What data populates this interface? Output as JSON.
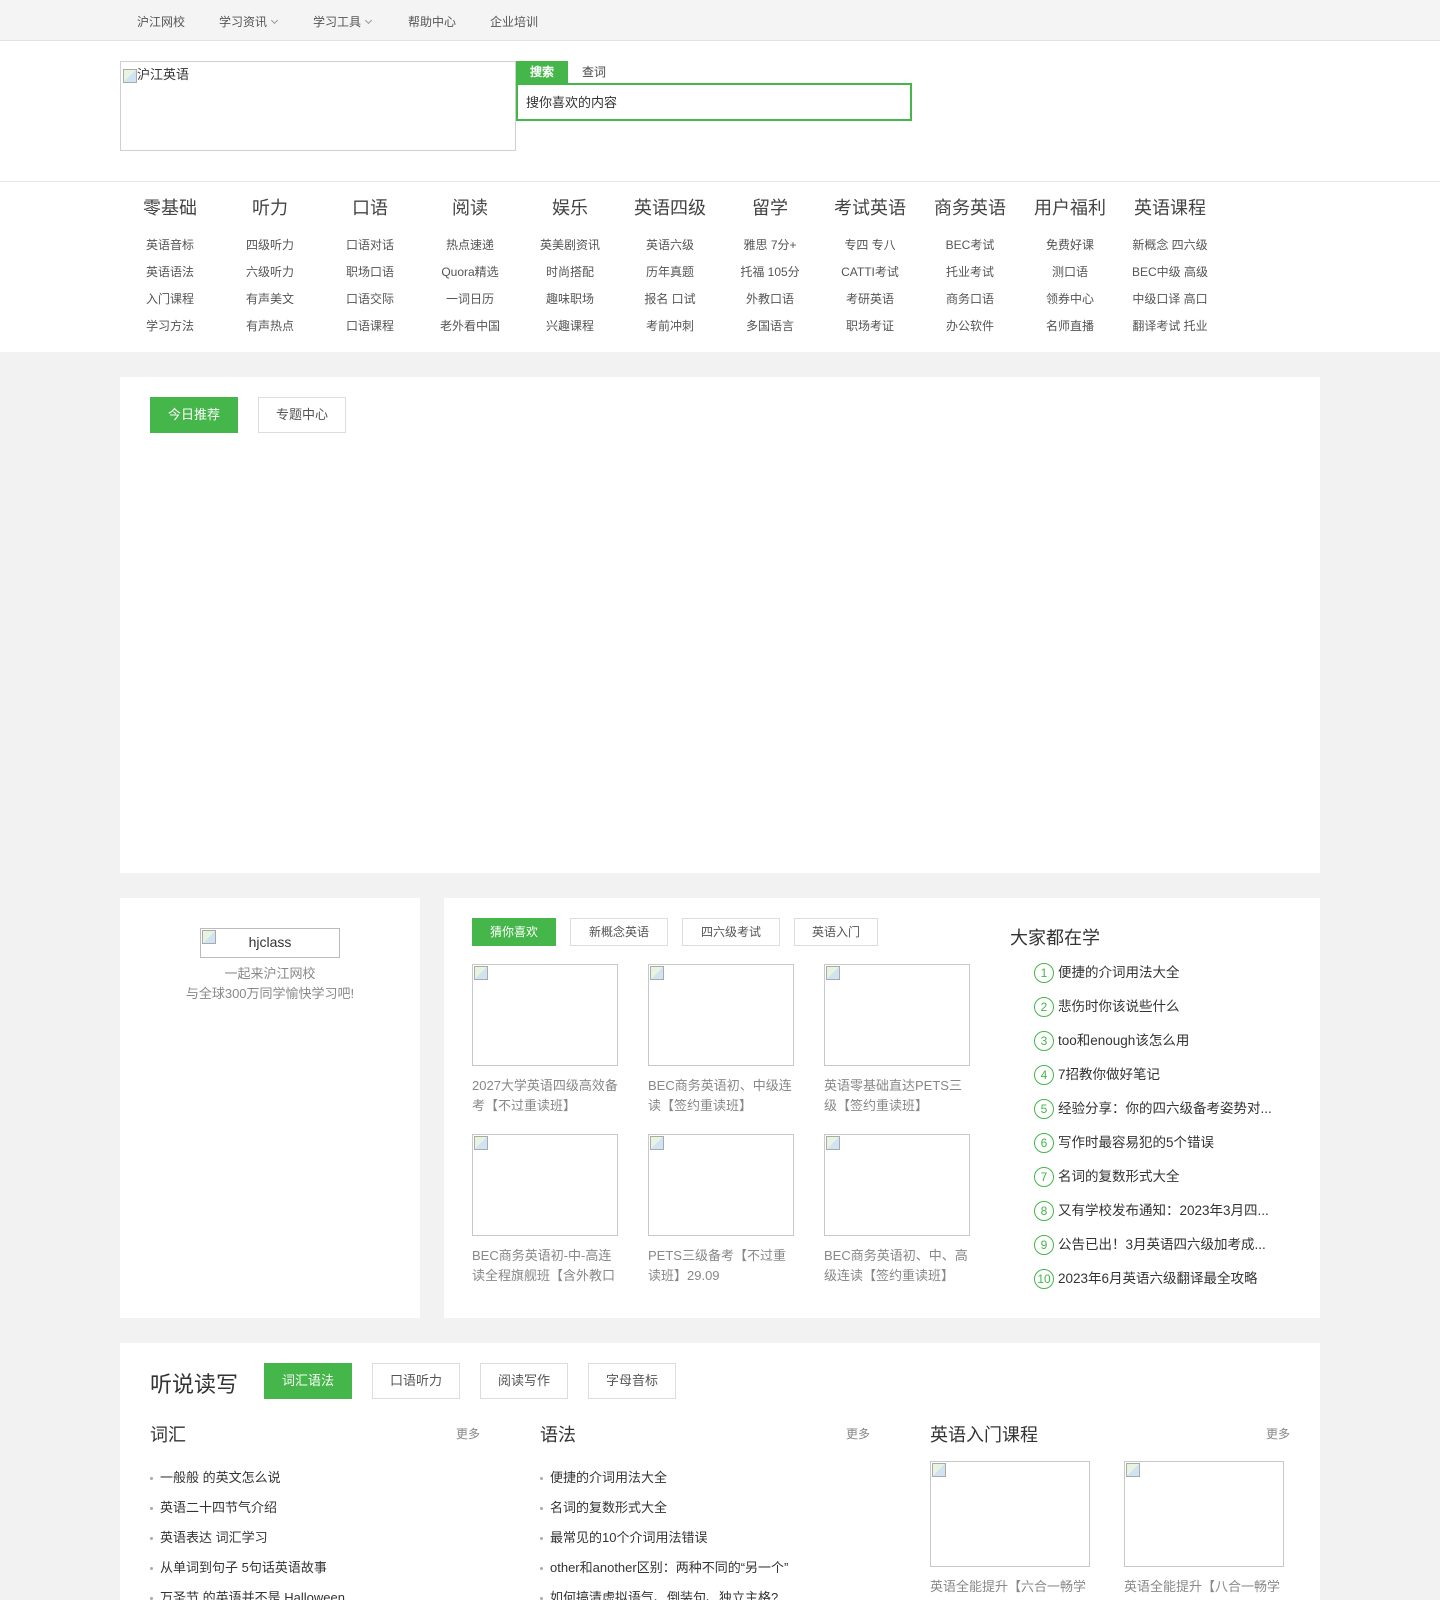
{
  "topbar": {
    "items": [
      "沪江网校",
      "学习资讯",
      "学习工具",
      "帮助中心",
      "企业培训"
    ]
  },
  "header": {
    "logo_alt": "沪江英语",
    "search_tab_active": "搜索",
    "search_tab_other": "查词",
    "search_placeholder": "搜你喜欢的内容"
  },
  "catnav": {
    "columns": [
      {
        "title": "零基础",
        "links": [
          "英语音标",
          "英语语法",
          "入门课程",
          "学习方法"
        ]
      },
      {
        "title": "听力",
        "links": [
          "四级听力",
          "六级听力",
          "有声美文",
          "有声热点"
        ]
      },
      {
        "title": "口语",
        "links": [
          "口语对话",
          "职场口语",
          "口语交际",
          "口语课程"
        ]
      },
      {
        "title": "阅读",
        "links": [
          "热点速递",
          "Quora精选",
          "一词日历",
          "老外看中国"
        ]
      },
      {
        "title": "娱乐",
        "links": [
          "英美剧资讯",
          "时尚搭配",
          "趣味职场",
          "兴趣课程"
        ]
      },
      {
        "title": "英语四级",
        "links": [
          "英语六级",
          "历年真题",
          "报名 口试",
          "考前冲刺"
        ]
      },
      {
        "title": "留学",
        "links": [
          "雅思 7分+",
          "托福 105分",
          "外教口语",
          "多国语言"
        ]
      },
      {
        "title": "考试英语",
        "links": [
          "专四 专八",
          "CATTI考试",
          "考研英语",
          "职场考证"
        ]
      },
      {
        "title": "商务英语",
        "links": [
          "BEC考试",
          "托业考试",
          "商务口语",
          "办公软件"
        ]
      },
      {
        "title": "用户福利",
        "links": [
          "免费好课",
          "测口语",
          "领券中心",
          "名师直播"
        ]
      },
      {
        "title": "英语课程",
        "links": [
          "新概念 四六级",
          "BEC中级 高级",
          "中级口译 高口",
          "翻译考试 托业"
        ]
      }
    ]
  },
  "recommend": {
    "tabs": [
      "今日推荐",
      "专题中心"
    ]
  },
  "hjclass": {
    "alt": "hjclass",
    "line1": "一起来沪江网校",
    "line2": "与全球300万同学愉快学习吧!"
  },
  "guess": {
    "tabs": [
      "猜你喜欢",
      "新概念英语",
      "四六级考试",
      "英语入门"
    ],
    "courses": [
      "2027大学英语四级高效备考【不过重读班】",
      "BEC商务英语初、中级连读【签约重读班】",
      "英语零基础直达PETS三级【签约重读班】",
      "BEC商务英语初-中-高连读全程旗舰班【含外教口",
      "PETS三级备考【不过重读班】29.09",
      "BEC商务英语初、中、高级连读【签约重读班】"
    ]
  },
  "ranking": {
    "title": "大家都在学",
    "items": [
      "便捷的介词用法大全",
      "悲伤时你该说些什么",
      "too和enough该怎么用",
      "7招教你做好笔记",
      "经验分享：你的四六级备考姿势对...",
      "写作时最容易犯的5个错误",
      "名词的复数形式大全",
      "又有学校发布通知：2023年3月四...",
      "公告已出！3月英语四六级加考成...",
      "2023年6月英语六级翻译最全攻略"
    ]
  },
  "skills": {
    "title": "听说读写",
    "tabs": [
      "词汇语法",
      "口语听力",
      "阅读写作",
      "字母音标"
    ],
    "more": "更多",
    "vocab": {
      "title": "词汇",
      "items": [
        "一般般 的英文怎么说",
        "英语二十四节气介绍",
        "英语表达 词汇学习",
        "从单词到句子 5句话英语故事",
        "万圣节 的英语并不是 Halloween"
      ]
    },
    "grammar": {
      "title": "语法",
      "items": [
        "便捷的介词用法大全",
        "名词的复数形式大全",
        "最常见的10个介词用法错误",
        "other和another区别：两种不同的“另一个”",
        "如何搞清虚拟语气、倒装句、独立主格?"
      ]
    },
    "intro": {
      "title": "英语入门课程",
      "courses": [
        "英语全能提升【六合一畅学",
        "英语全能提升【八合一畅学"
      ]
    }
  }
}
